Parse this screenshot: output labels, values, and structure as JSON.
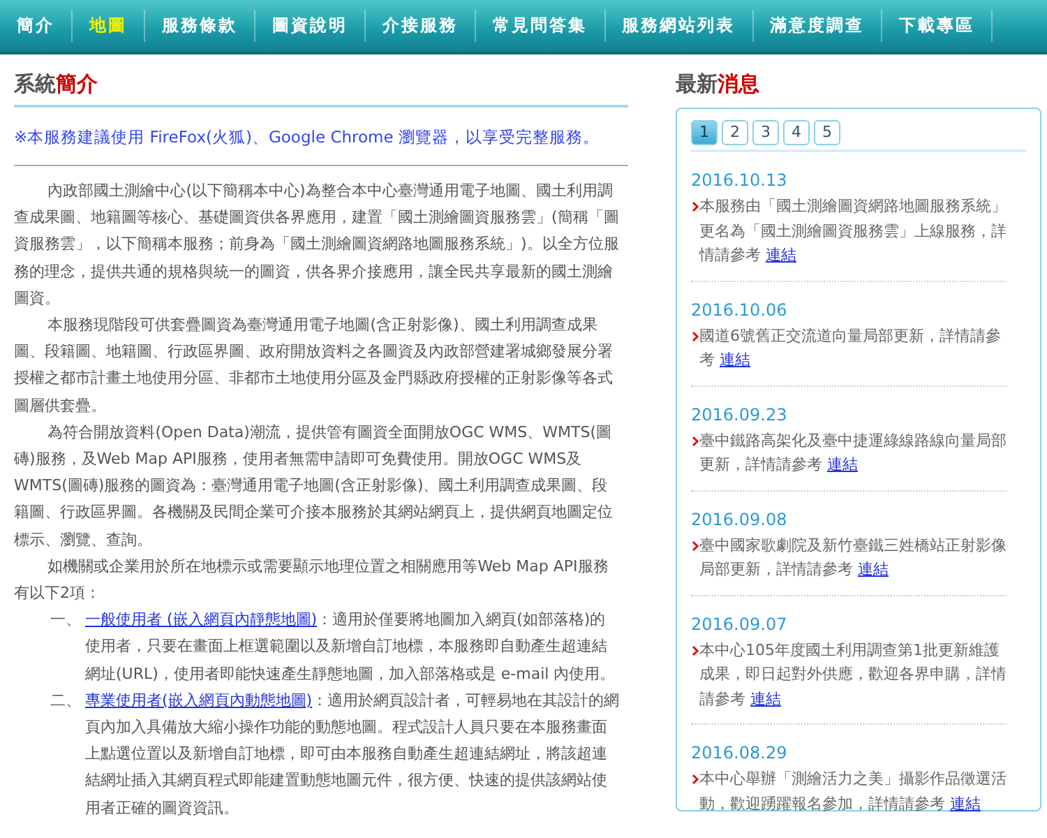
{
  "nav": [
    {
      "label": "簡介",
      "selected": false
    },
    {
      "label": "地圖",
      "selected": true
    },
    {
      "label": "服務條款",
      "selected": false
    },
    {
      "label": "圖資說明",
      "selected": false
    },
    {
      "label": "介接服務",
      "selected": false
    },
    {
      "label": "常見問答集",
      "selected": false
    },
    {
      "label": "服務網站列表",
      "selected": false
    },
    {
      "label": "滿意度調查",
      "selected": false
    },
    {
      "label": "下載專區",
      "selected": false
    }
  ],
  "intro": {
    "heading": {
      "plain": "系統",
      "accent": "簡介"
    },
    "notice": "※本服務建議使用 FireFox(火狐)、Google Chrome 瀏覽器，以享受完整服務。",
    "paragraphs": [
      "內政部國土測繪中心(以下簡稱本中心)為整合本中心臺灣通用電子地圖、國土利用調查成果圖、地籍圖等核心、基礎圖資供各界應用，建置「國土測繪圖資服務雲」(簡稱「圖資服務雲」，以下簡稱本服務；前身為「國土測繪圖資網路地圖服務系統」)。以全方位服務的理念，提供共通的規格與統一的圖資，供各界介接應用，讓全民共享最新的國土測繪圖資。",
      "本服務現階段可供套疊圖資為臺灣通用電子地圖(含正射影像)、國土利用調查成果圖、段籍圖、地籍圖、行政區界圖、政府開放資料之各圖資及內政部營建署城鄉發展分署授權之都市計畫土地使用分區、非都市土地使用分區及金門縣政府授權的正射影像等各式圖層供套疊。",
      "為符合開放資料(Open Data)潮流，提供管有圖資全面開放OGC WMS、WMTS(圖磚)服務，及Web Map API服務，使用者無需申請即可免費使用。開放OGC WMS及WMTS(圖磚)服務的圖資為：臺灣通用電子地圖(含正射影像)、國土利用調查成果圖、段籍圖、行政區界圖。各機關及民間企業可介接本服務於其網站網頁上，提供網頁地圖定位標示、瀏覽、查詢。",
      "如機關或企業用於所在地標示或需要顯示地理位置之相關應用等Web Map API服務有以下2項："
    ],
    "items": [
      {
        "ordinal": "一、",
        "link": "一般使用者 (嵌入網頁內靜態地圖)",
        "text": "：適用於僅要將地圖加入網頁(如部落格)的使用者，只要在畫面上框選範圍以及新增自訂地標，本服務即自動產生超連結網址(URL)，使用者即能快速產生靜態地圖，加入部落格或是 e-mail 內使用。"
      },
      {
        "ordinal": "二、",
        "link": "專業使用者(嵌入網頁內動態地圖)",
        "text": "：適用於網頁設計者，可輕易地在其設計的網頁內加入具備放大縮小操作功能的動態地圖。程式設計人員只要在本服務畫面上點選位置以及新增自訂地標，即可由本服務自動產生超連結網址，將該超連結網址插入其網頁程式即能建置動態地圖元件，很方便、快速的提供該網站使用者正確的圖資資訊。"
      }
    ]
  },
  "news": {
    "heading": {
      "plain": "最新",
      "accent": "消息"
    },
    "pages": [
      {
        "label": "1",
        "selected": true
      },
      {
        "label": "2",
        "selected": false
      },
      {
        "label": "3",
        "selected": false
      },
      {
        "label": "4",
        "selected": false
      },
      {
        "label": "5",
        "selected": false
      }
    ],
    "items": [
      {
        "date": "2016.10.13",
        "text": "本服務由「國土測繪圖資網路地圖服務系統」更名為「國土測繪圖資服務雲」上線服務，詳情請參考",
        "link": "連結"
      },
      {
        "date": "2016.10.06",
        "text": "國道6號舊正交流道向量局部更新，詳情請參考",
        "link": "連結"
      },
      {
        "date": "2016.09.23",
        "text": "臺中鐵路高架化及臺中捷運綠線路線向量局部更新，詳情請參考",
        "link": "連結"
      },
      {
        "date": "2016.09.08",
        "text": "臺中國家歌劇院及新竹臺鐵三姓橋站正射影像局部更新，詳情請參考",
        "link": "連結"
      },
      {
        "date": "2016.09.07",
        "text": "本中心105年度國土利用調查第1批更新維護成果，即日起對外供應，歡迎各界申購，詳情請參考",
        "link": "連結"
      },
      {
        "date": "2016.08.29",
        "text": "本中心舉辦「測繪活力之美」攝影作品徵選活動，歡迎踴躍報名參加，詳情請參考",
        "link": "連結"
      }
    ]
  }
}
